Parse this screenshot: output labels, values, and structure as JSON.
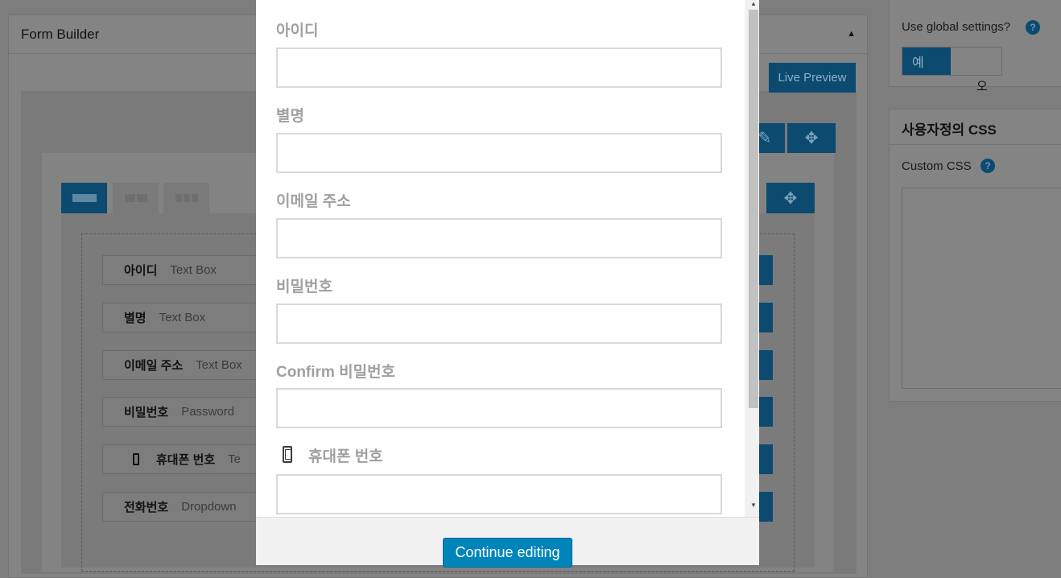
{
  "background": {
    "panel_title": "Form Builder",
    "collapse_icon": "triangle-up-icon",
    "live_preview_label": "Live Preview",
    "fields": [
      {
        "name": "아이디",
        "type": "Text Box"
      },
      {
        "name": "별명",
        "type": "Text Box"
      },
      {
        "name": "이메일 주소",
        "type": "Text Box"
      },
      {
        "name": "비밀번호",
        "type": "Password"
      },
      {
        "name": "휴대폰 번호",
        "type": "Te"
      },
      {
        "name": "전화번호",
        "type": "Dropdown"
      }
    ]
  },
  "sidebar": {
    "global_settings_label": "Use global settings?",
    "toggle_yes": "예",
    "toggle_no": "오",
    "custom_css_heading": "사용자정의 CSS",
    "custom_css_label": "Custom CSS",
    "help_glyph": "?"
  },
  "modal": {
    "fields": [
      {
        "label": "아이디",
        "value": ""
      },
      {
        "label": "별명",
        "value": ""
      },
      {
        "label": "이메일 주소",
        "value": ""
      },
      {
        "label": "비밀번호",
        "value": ""
      },
      {
        "label": "Confirm 비밀번호",
        "value": ""
      },
      {
        "label": "휴대폰 번호",
        "value": "",
        "icon": "mobile-phone-icon"
      }
    ],
    "continue_label": "Continue editing"
  },
  "colors": {
    "accent": "#0085ba",
    "overlay": "#7d7d7d",
    "label_gray": "#a0a0a0"
  }
}
